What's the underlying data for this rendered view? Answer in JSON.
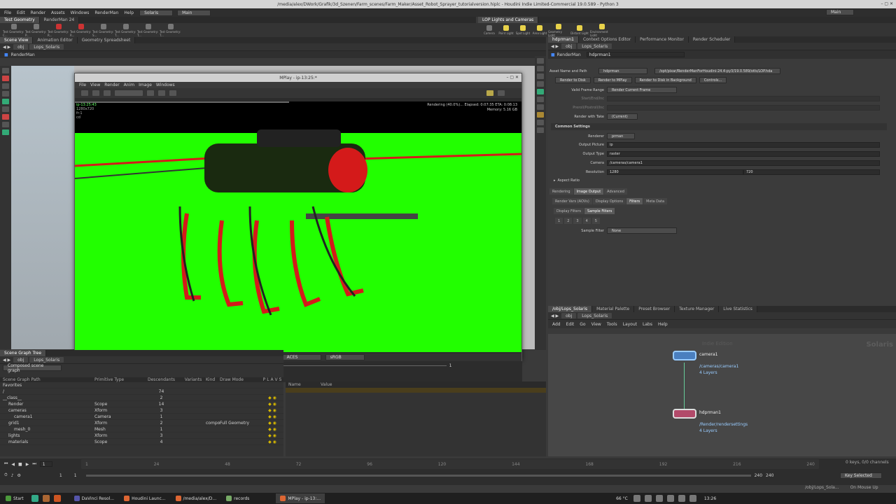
{
  "window": {
    "title": "/media/alex/DWork/Grafik/3d_Szenen/Farm_scenes/Farm_Maker/Asset_Robot_Sprayer_tutorialversion.hiplc - Houdini Indie Limited-Commercial 19.0.589 - Python 3"
  },
  "menu": {
    "items": [
      "File",
      "Edit",
      "Render",
      "Assets",
      "Windows",
      "RenderMan",
      "Help"
    ],
    "desktop": "Solaris",
    "main": "Main",
    "right_main": "Main"
  },
  "shelf": {
    "tabs": [
      "Test Geometry",
      "RenderMan 24"
    ],
    "tools": [
      "Test Geometry: C...",
      "Test Geometry: P...",
      "Test Geometry: R...",
      "Test Geometry: R...",
      "Test Geometry: S...",
      "Test Geometry: T...",
      "Test Geometry: T...",
      "Test Geometry: T..."
    ]
  },
  "light_shelf": {
    "tab": "LOP Lights and Cameras",
    "tools": [
      "Camera",
      "Point Light",
      "Spot Light",
      "Area Light",
      "Geometry Light",
      "Distant Light",
      "Environment Light"
    ]
  },
  "left_pane": {
    "tabs": [
      "Scene View",
      "Animation Editor",
      "Geometry Spreadsheet"
    ],
    "path": [
      "obj",
      "Lops_Solaris"
    ],
    "renderer": "RenderMan"
  },
  "mplay": {
    "title": "MPlay - ip-13:25:*",
    "menu": [
      "File",
      "View",
      "Render",
      "Anim",
      "Image",
      "Windows"
    ],
    "info": {
      "name": "ip-13:25:43",
      "res": "1280x720",
      "frame": "fr:1",
      "c": "cd"
    },
    "status": "Rendering (40.0%)...   Elapsed: 0:07:35   ETA: 0:08:13",
    "memory_label": "Memory:",
    "memory": "5.16 GB",
    "frame": "1",
    "exposure": "0",
    "colorspace": "ACES",
    "display": "sRGB",
    "start": "1",
    "end": "1",
    "fps": "24"
  },
  "scene_graph": {
    "tabs": [
      "Scene Graph Tree"
    ],
    "path": [
      "obj",
      "Lops_Solaris"
    ],
    "filter": "Composed scene graph",
    "headers": [
      "Scene Graph Path",
      "Primitive Type",
      "Descendants",
      "Variants",
      "Kind",
      "Draw Mode",
      "P",
      "L",
      "A",
      "V",
      "S"
    ],
    "rows": [
      {
        "path": "Favorites",
        "type": "",
        "desc": "",
        "var": "",
        "kind": "",
        "draw": ""
      },
      {
        "path": "/",
        "type": "",
        "desc": "74",
        "var": "",
        "kind": "",
        "draw": ""
      },
      {
        "path": "__class__",
        "type": "",
        "desc": "2",
        "var": "",
        "kind": "",
        "draw": ""
      },
      {
        "path": "Render",
        "type": "Scope",
        "desc": "14",
        "var": "",
        "kind": "",
        "draw": ""
      },
      {
        "path": "cameras",
        "type": "Xform",
        "desc": "3",
        "var": "",
        "kind": "",
        "draw": ""
      },
      {
        "path": "camera1",
        "type": "Camera",
        "desc": "1",
        "var": "",
        "kind": "",
        "draw": ""
      },
      {
        "path": "grid1",
        "type": "Xform",
        "desc": "2",
        "var": "",
        "kind": "compo",
        "draw": "Full Geometry"
      },
      {
        "path": "mesh_0",
        "type": "Mesh",
        "desc": "1",
        "var": "",
        "kind": "",
        "draw": ""
      },
      {
        "path": "lights",
        "type": "Xform",
        "desc": "3",
        "var": "",
        "kind": "",
        "draw": ""
      },
      {
        "path": "materials",
        "type": "Scope",
        "desc": "4",
        "var": "",
        "kind": "",
        "draw": ""
      }
    ]
  },
  "attributes": {
    "headers": [
      "Name",
      "Value"
    ]
  },
  "right_pane": {
    "tabs": [
      "hdprman1",
      "Context Options Editor",
      "Performance Monitor",
      "Render Scheduler"
    ],
    "path": [
      "obj",
      "Lops_Solaris"
    ],
    "node_type": "RenderMan",
    "node_name": "hdprman1",
    "asset_label": "Asset Name and Path",
    "asset_name": "hdprman",
    "asset_path": "/opt/pixar/RenderManForHoudini-24.4-py3/19.0.589/otls/LOP.hda",
    "buttons": [
      "Render to Disk",
      "Render to MPlay",
      "Render to Disk in Background",
      "Controls..."
    ],
    "params": [
      {
        "label": "Valid Frame Range",
        "value": "Render Current Frame"
      },
      {
        "label": "Start/End/Inc",
        "value": ""
      },
      {
        "label": "Preroll/Postroll/Inc",
        "value": ""
      },
      {
        "label": "Render with Take",
        "value": "(Current)"
      }
    ],
    "common_settings": "Common Settings",
    "common": [
      {
        "label": "Renderer",
        "value": "prman"
      },
      {
        "label": "Output Picture",
        "value": "ip"
      },
      {
        "label": "Output Type",
        "value": "raster"
      },
      {
        "label": "Camera",
        "value": "/cameras/camera1"
      }
    ],
    "resolution_label": "Resolution",
    "res_x": "1280",
    "res_y": "720",
    "aspect": "Aspect Ratio",
    "tabs1": [
      "Rendering",
      "Image Output",
      "Advanced"
    ],
    "tabs2": [
      "Render Vars (AOVs)",
      "Display Options",
      "Filters",
      "Meta Data"
    ],
    "tabs3": [
      "Display Filters",
      "Sample Filters"
    ],
    "index_tabs": [
      "1",
      "2",
      "3",
      "4",
      "5"
    ],
    "sample_filter_label": "Sample Filter",
    "sample_filter": "None"
  },
  "network": {
    "tabs": [
      "/obj/Lops_Solaris",
      "Material Palette",
      "Preset Browser",
      "Texture Manager",
      "Live Statistics"
    ],
    "path": [
      "obj",
      "Lops_Solaris"
    ],
    "menu": [
      "Add",
      "Edit",
      "Go",
      "View",
      "Tools",
      "Layout",
      "Labs",
      "Help"
    ],
    "watermark_small": "Indie Edition",
    "watermark": "Solaris",
    "nodes": [
      {
        "name": "camera1",
        "sub": "/cameras/camera1",
        "layers": "4 Layers"
      },
      {
        "name": "hdprman1",
        "sub": "/Render/rendersettings",
        "layers": "4 Layers"
      }
    ]
  },
  "playbar": {
    "frame": "1",
    "start": "1",
    "end": "1",
    "ticks": [
      "1",
      "24",
      "48",
      "72",
      "96",
      "120",
      "144",
      "168",
      "192",
      "216",
      "240"
    ],
    "range_end": "240",
    "range_end2": "240",
    "keys": "0 keys, 0/0 channels",
    "key_label": "Key Selected",
    "path": "/obj/Lops_Sola...",
    "auto": "On Mouse Up"
  },
  "taskbar": {
    "start": "Start",
    "apps": [
      "DaVinci Resol...",
      "Houdini Launc...",
      "/media/alex/D...",
      "records",
      "MPlay - ip-13:..."
    ],
    "temp": "66 °C",
    "clock": "13:26"
  },
  "colors": {
    "green": "#22ff00",
    "accent": "#d7b800",
    "robot_red": "#d41a1a"
  }
}
